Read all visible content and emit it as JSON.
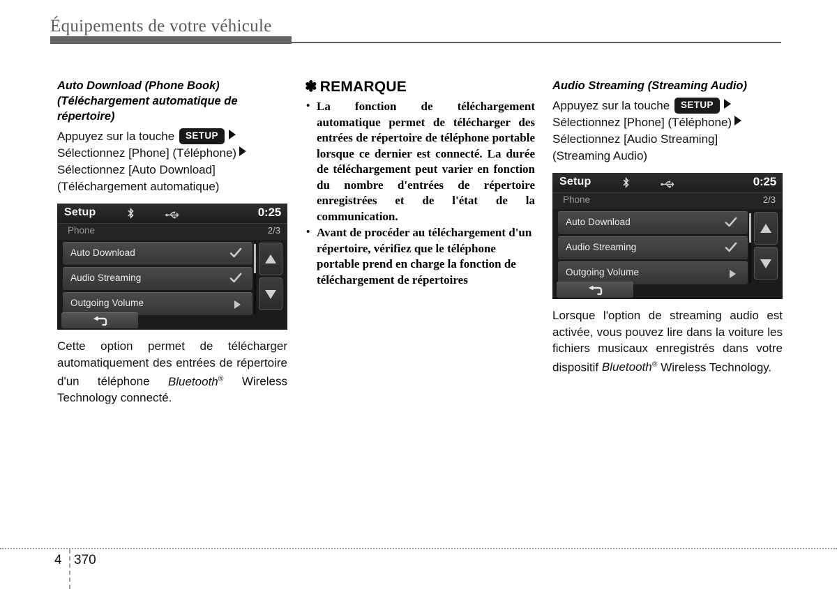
{
  "header": {
    "title": "Équipements de votre véhicule"
  },
  "footer": {
    "chapter": "4",
    "page_number": "370"
  },
  "common": {
    "setup_key_label": "SETUP",
    "bluetooth_word": "Bluetooth",
    "registered_mark": "®"
  },
  "left_column": {
    "heading": "Auto Download (Phone Book) (Téléchargement automatique de répertoire)",
    "steps": {
      "line1_before_key": "Appuyez sur la touche",
      "line2": "Sélectionnez [Phone] (Téléphone)",
      "line3": "Sélectionnez [Auto Download]",
      "line4": "(Téléchargement automatique)"
    },
    "body_before_bt": "Cette option permet de télécharger automatiquement des entrées de répertoire d'un téléphone ",
    "body_after_bt": " Wireless Technology connecté."
  },
  "note": {
    "star": "✽",
    "heading": "REMARQUE",
    "bullets": [
      "La fonction de téléchargement automatique permet de télécharger des entrées de répertoire de téléphone portable lorsque ce dernier est connecté. La durée de téléchargement peut varier en fonction du nombre d'entrées de répertoire enregistrées et de l'état de la communication.",
      "Avant de procéder au téléchargement d'un répertoire, vérifiez que le téléphone portable prend en charge la fonction de téléchargement de répertoires"
    ]
  },
  "right_column": {
    "heading": "Audio Streaming (Streaming Audio)",
    "steps": {
      "line1_before_key": "Appuyez sur la touche",
      "line2": "Sélectionnez [Phone] (Téléphone)",
      "line3": "Sélectionnez [Audio Streaming]",
      "line4": "(Streaming Audio)"
    },
    "body_before_bt": "Lorsque l'option de streaming audio est activée, vous pouvez lire dans la voiture les fichiers musicaux enregistrés dans votre dispositif ",
    "body_after_bt": " Wireless Technology."
  },
  "device_screen": {
    "title": "Setup",
    "clock": "0:25",
    "subtitle": "Phone",
    "page_indicator": "2/3",
    "rows": [
      {
        "label": "Auto Download",
        "control": "check"
      },
      {
        "label": "Audio Streaming",
        "control": "check"
      },
      {
        "label": "Outgoing Volume",
        "control": "chevron"
      }
    ]
  }
}
